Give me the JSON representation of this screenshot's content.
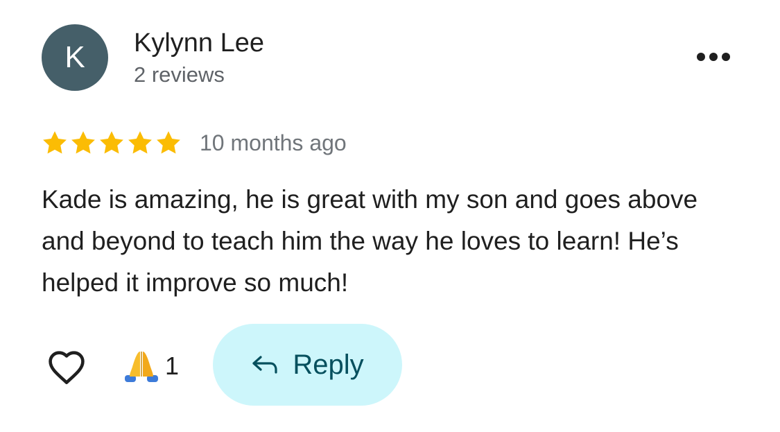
{
  "author": {
    "initial": "K",
    "name": "Kylynn Lee",
    "reviews": "2 reviews",
    "avatar_color": "#455f69"
  },
  "rating": {
    "stars": 5,
    "max": 5,
    "star_color": "#fbbc04"
  },
  "timestamp": "10 months ago",
  "review_text": "Kade is amazing, he is great with my son and goes above and beyond to teach him the way he loves to learn! He’s helped it improve so much!",
  "actions": {
    "like_icon": "heart-outline-icon",
    "reaction_icon": "folded-hands-emoji",
    "reaction_count": "1",
    "reply_label": "Reply",
    "reply_icon": "reply-arrow-icon",
    "reply_bg": "#cdf6fb",
    "reply_color": "#06505e"
  },
  "menu_icon": "more-horizontal-icon"
}
